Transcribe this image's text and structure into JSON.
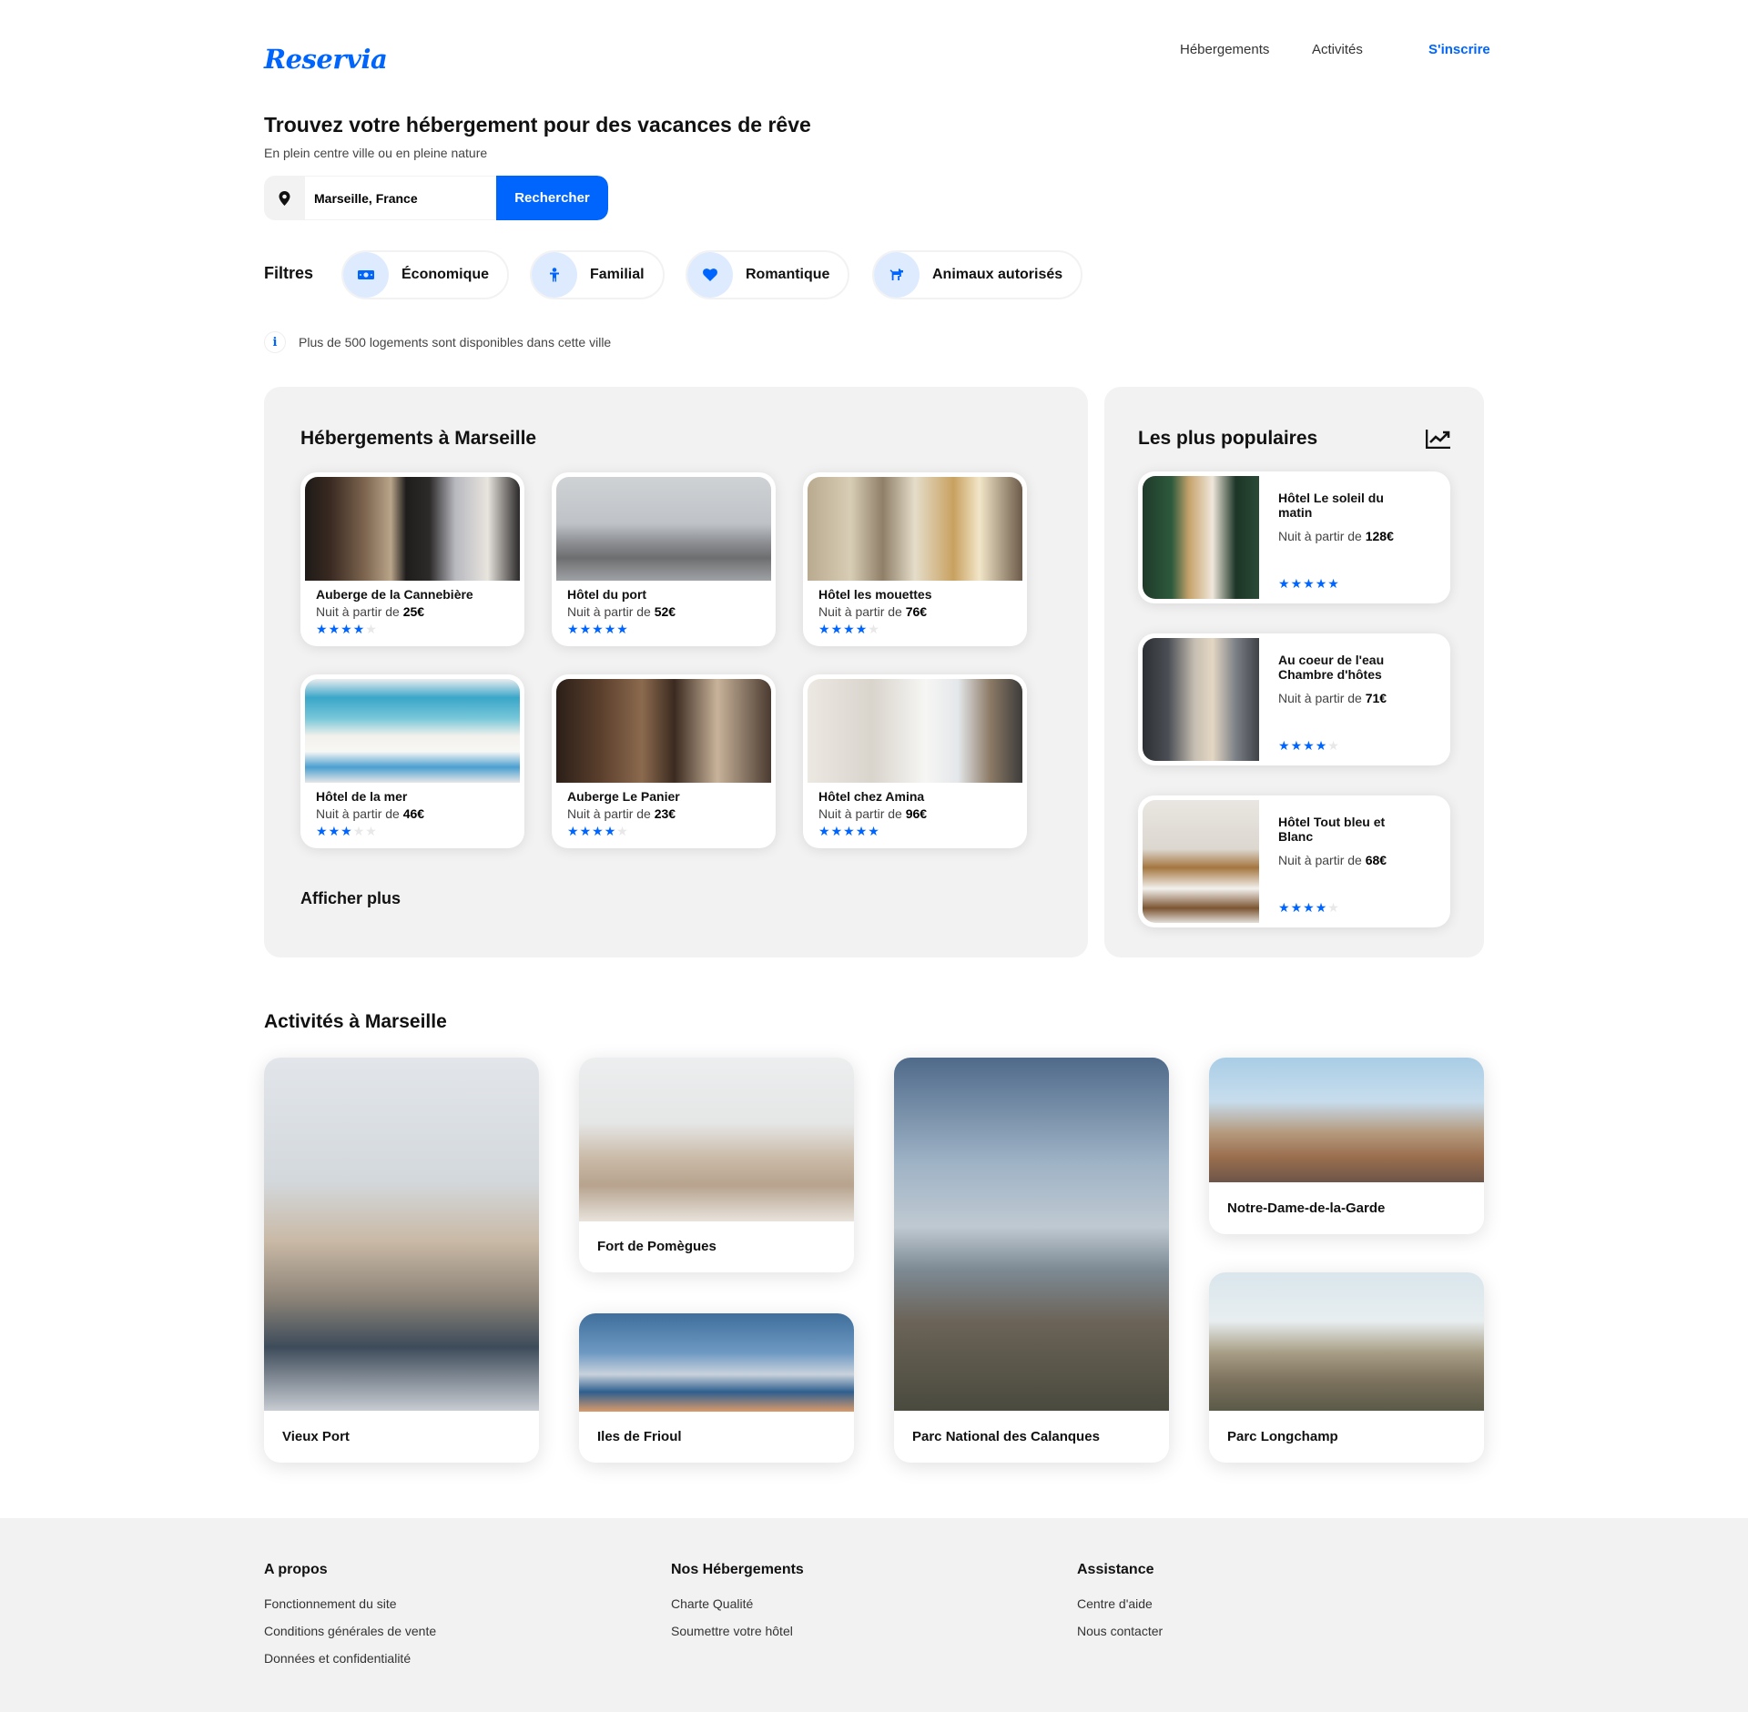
{
  "header": {
    "logo": "Reservia",
    "nav": [
      "Hébergements",
      "Activités"
    ],
    "signup": "S'inscrire"
  },
  "hero": {
    "title": "Trouvez votre hébergement pour des vacances de rêve",
    "subtitle": "En plein centre ville ou en pleine nature",
    "search_value": "Marseille, France",
    "search_button": "Rechercher"
  },
  "filters": {
    "label": "Filtres",
    "items": [
      {
        "label": "Économique",
        "icon": "money-icon"
      },
      {
        "label": "Familial",
        "icon": "child-icon"
      },
      {
        "label": "Romantique",
        "icon": "heart-icon"
      },
      {
        "label": "Animaux autorisés",
        "icon": "dog-icon"
      }
    ]
  },
  "info": "Plus de 500 logements sont disponibles dans cette ville",
  "accommodations": {
    "title": "Hébergements à Marseille",
    "price_prefix": "Nuit à partir de",
    "items": [
      {
        "name": "Auberge de la Cannebière",
        "price": "25€",
        "rating": 4
      },
      {
        "name": "Hôtel du port",
        "price": "52€",
        "rating": 5
      },
      {
        "name": "Hôtel les mouettes",
        "price": "76€",
        "rating": 4
      },
      {
        "name": "Hôtel de la mer",
        "price": "46€",
        "rating": 3
      },
      {
        "name": "Auberge Le Panier",
        "price": "23€",
        "rating": 4
      },
      {
        "name": "Hôtel chez Amina",
        "price": "96€",
        "rating": 5
      }
    ],
    "show_more": "Afficher plus"
  },
  "popular": {
    "title": "Les plus populaires",
    "icon": "trending-icon",
    "items": [
      {
        "name": "Hôtel Le soleil du matin",
        "price": "128€",
        "rating": 5
      },
      {
        "name": "Au coeur de l'eau Chambre d'hôtes",
        "price": "71€",
        "rating": 4
      },
      {
        "name": "Hôtel Tout bleu et Blanc",
        "price": "68€",
        "rating": 4
      }
    ]
  },
  "activities": {
    "title": "Activités à Marseille",
    "items": [
      {
        "name": "Vieux Port"
      },
      {
        "name": "Fort de Pomègues"
      },
      {
        "name": "Iles de Frioul"
      },
      {
        "name": "Parc National des Calanques"
      },
      {
        "name": "Notre-Dame-de-la-Garde"
      },
      {
        "name": "Parc Longchamp"
      }
    ]
  },
  "footer": {
    "columns": [
      {
        "title": "A propos",
        "links": [
          "Fonctionnement du site",
          "Conditions générales de vente",
          "Données et confidentialité"
        ]
      },
      {
        "title": "Nos Hébergements",
        "links": [
          "Charte Qualité",
          "Soumettre votre hôtel"
        ]
      },
      {
        "title": "Assistance",
        "links": [
          "Centre d'aide",
          "Nous contacter"
        ]
      }
    ]
  },
  "colors": {
    "accent": "#0065fc",
    "panel": "#f2f2f2",
    "filter_icon_bg": "#deebff"
  }
}
